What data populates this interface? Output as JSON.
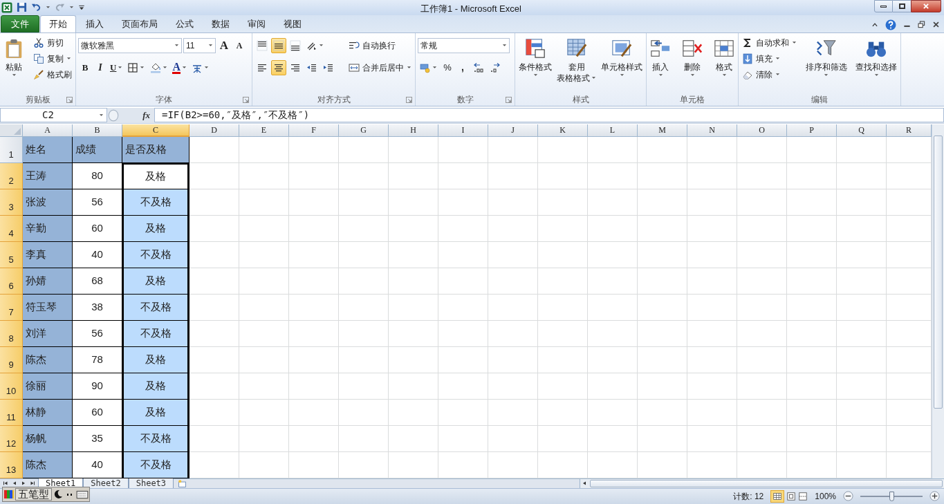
{
  "title_bar": {
    "title": "工作簿1 - Microsoft Excel"
  },
  "tabs": [
    {
      "label": "文件",
      "kind": "file",
      "selected": false
    },
    {
      "label": "开始",
      "kind": "tab",
      "selected": true
    },
    {
      "label": "插入",
      "kind": "tab",
      "selected": false
    },
    {
      "label": "页面布局",
      "kind": "tab",
      "selected": false
    },
    {
      "label": "公式",
      "kind": "tab",
      "selected": false
    },
    {
      "label": "数据",
      "kind": "tab",
      "selected": false
    },
    {
      "label": "审阅",
      "kind": "tab",
      "selected": false
    },
    {
      "label": "视图",
      "kind": "tab",
      "selected": false
    }
  ],
  "ribbon": {
    "groups": [
      {
        "label": "剪贴板",
        "launcher": true,
        "stacks": [
          {
            "kind": "large",
            "label": "粘贴",
            "dropdown": true
          },
          {
            "kind": "stack",
            "lines": [
              [
                {
                  "kind": "small",
                  "label": "剪切"
                }
              ],
              [
                {
                  "kind": "small",
                  "label": "复制",
                  "dropdown": true
                }
              ],
              [
                {
                  "kind": "small",
                  "label": "格式刷"
                }
              ]
            ]
          }
        ]
      },
      {
        "label": "字体",
        "launcher": true,
        "stacks": [
          {
            "kind": "stack",
            "lines": [
              [
                {
                  "kind": "dropdown",
                  "value": "微软雅黑"
                },
                {
                  "kind": "dropdown",
                  "value": "11"
                },
                {
                  "kind": "glyph",
                  "label": "A"
                },
                {
                  "kind": "glyph",
                  "label": "A"
                }
              ],
              [
                {
                  "kind": "glyph",
                  "label": "B"
                },
                {
                  "kind": "glyph",
                  "label": "I"
                },
                {
                  "kind": "glyph",
                  "label": "U",
                  "dropdown": true
                },
                {
                  "kind": "icon",
                  "dropdown": true,
                  "selected": false
                },
                {
                  "kind": "icon",
                  "dropdown": true,
                  "selected": false
                },
                {
                  "kind": "glyph",
                  "label": "A",
                  "dropdown": true
                },
                {
                  "kind": "icon",
                  "dropdown": true,
                  "selected": false
                }
              ]
            ]
          }
        ]
      },
      {
        "label": "对齐方式",
        "launcher": true,
        "stacks": [
          {
            "kind": "stack",
            "lines": [
              [
                {
                  "kind": "icon",
                  "selected": false
                },
                {
                  "kind": "icon",
                  "selected": true
                },
                {
                  "kind": "icon",
                  "selected": false
                },
                {
                  "kind": "icon",
                  "dropdown": true,
                  "selected": false
                }
              ],
              [
                {
                  "kind": "icon",
                  "selected": false
                },
                {
                  "kind": "icon",
                  "selected": true
                },
                {
                  "kind": "icon",
                  "selected": false
                },
                {
                  "kind": "icon",
                  "selected": false
                },
                {
                  "kind": "icon",
                  "selected": false
                }
              ]
            ]
          },
          {
            "kind": "stack",
            "lines": [
              [
                {
                  "kind": "small",
                  "label": "自动换行"
                }
              ],
              [
                {
                  "kind": "small",
                  "label": "合并后居中",
                  "dropdown": true
                }
              ]
            ]
          }
        ]
      },
      {
        "label": "数字",
        "launcher": true,
        "stacks": [
          {
            "kind": "stack",
            "lines": [
              [
                {
                  "kind": "dropdown",
                  "value": "常规"
                }
              ],
              [
                {
                  "kind": "icon",
                  "dropdown": true,
                  "selected": false
                },
                {
                  "kind": "glyph",
                  "label": "%"
                },
                {
                  "kind": "glyph",
                  "label": ","
                },
                {
                  "kind": "icon",
                  "selected": false
                },
                {
                  "kind": "icon",
                  "selected": false
                }
              ]
            ]
          }
        ]
      },
      {
        "label": "样式",
        "stacks": [
          {
            "kind": "large",
            "label": "条件格式",
            "dropdown": true
          },
          {
            "kind": "large",
            "label": "套用",
            "label_2": "表格格式",
            "dropdown": true
          },
          {
            "kind": "large",
            "label": "单元格样式",
            "dropdown": true
          }
        ]
      },
      {
        "label": "单元格",
        "stacks": [
          {
            "kind": "large",
            "label": "插入",
            "dropdown": true
          },
          {
            "kind": "large",
            "label": "删除",
            "dropdown": true
          },
          {
            "kind": "large",
            "label": "格式",
            "dropdown": true
          }
        ]
      },
      {
        "label": "编辑",
        "stacks": [
          {
            "kind": "stack",
            "lines": [
              [
                {
                  "kind": "small",
                  "label": "自动求和",
                  "dropdown": true
                }
              ],
              [
                {
                  "kind": "small",
                  "label": "填充",
                  "dropdown": true
                }
              ],
              [
                {
                  "kind": "small",
                  "label": "清除",
                  "dropdown": true
                }
              ]
            ]
          },
          {
            "kind": "large",
            "label": "排序和筛选",
            "dropdown": true
          },
          {
            "kind": "large",
            "label": "查找和选择",
            "dropdown": true
          }
        ]
      }
    ]
  },
  "formula_bar": {
    "name_box": "C2",
    "fx": "fx",
    "formula": "=IF(B2>=60,″及格″,″不及格″)"
  },
  "table": {
    "columns": [
      {
        "label": "A",
        "selected": false
      },
      {
        "label": "B",
        "selected": false
      },
      {
        "label": "C",
        "selected": true
      },
      {
        "label": "D",
        "selected": false
      },
      {
        "label": "E",
        "selected": false
      },
      {
        "label": "F",
        "selected": false
      },
      {
        "label": "G",
        "selected": false
      },
      {
        "label": "H",
        "selected": false
      },
      {
        "label": "I",
        "selected": false
      },
      {
        "label": "J",
        "selected": false
      },
      {
        "label": "K",
        "selected": false
      },
      {
        "label": "L",
        "selected": false
      },
      {
        "label": "M",
        "selected": false
      },
      {
        "label": "N",
        "selected": false
      },
      {
        "label": "O",
        "selected": false
      },
      {
        "label": "P",
        "selected": false
      },
      {
        "label": "Q",
        "selected": false
      },
      {
        "label": "R",
        "selected": false
      }
    ],
    "rows": [
      {
        "header": "1",
        "selected": false,
        "cells": [
          {
            "text": "姓名"
          },
          {
            "text": "成绩"
          },
          {
            "text": "是否及格"
          }
        ]
      },
      {
        "header": "2",
        "selected": true,
        "cells": [
          {
            "text": "王涛"
          },
          {
            "text": "80"
          },
          {
            "text": "及格",
            "selected": true,
            "active": true
          }
        ]
      },
      {
        "header": "3",
        "selected": true,
        "cells": [
          {
            "text": "张波"
          },
          {
            "text": "56"
          },
          {
            "text": "不及格",
            "selected": true,
            "active": false
          }
        ]
      },
      {
        "header": "4",
        "selected": true,
        "cells": [
          {
            "text": "辛勤"
          },
          {
            "text": "60"
          },
          {
            "text": "及格",
            "selected": true,
            "active": false
          }
        ]
      },
      {
        "header": "5",
        "selected": true,
        "cells": [
          {
            "text": "李真"
          },
          {
            "text": "40"
          },
          {
            "text": "不及格",
            "selected": true,
            "active": false
          }
        ]
      },
      {
        "header": "6",
        "selected": true,
        "cells": [
          {
            "text": "孙婧"
          },
          {
            "text": "68"
          },
          {
            "text": "及格",
            "selected": true,
            "active": false
          }
        ]
      },
      {
        "header": "7",
        "selected": true,
        "cells": [
          {
            "text": "符玉琴"
          },
          {
            "text": "38"
          },
          {
            "text": "不及格",
            "selected": true,
            "active": false
          }
        ]
      },
      {
        "header": "8",
        "selected": true,
        "cells": [
          {
            "text": "刘洋"
          },
          {
            "text": "56"
          },
          {
            "text": "不及格",
            "selected": true,
            "active": false
          }
        ]
      },
      {
        "header": "9",
        "selected": true,
        "cells": [
          {
            "text": "陈杰"
          },
          {
            "text": "78"
          },
          {
            "text": "及格",
            "selected": true,
            "active": false
          }
        ]
      },
      {
        "header": "10",
        "selected": true,
        "cells": [
          {
            "text": "徐丽"
          },
          {
            "text": "90"
          },
          {
            "text": "及格",
            "selected": true,
            "active": false
          }
        ]
      },
      {
        "header": "11",
        "selected": true,
        "cells": [
          {
            "text": "林静"
          },
          {
            "text": "60"
          },
          {
            "text": "及格",
            "selected": true,
            "active": false
          }
        ]
      },
      {
        "header": "12",
        "selected": true,
        "cells": [
          {
            "text": "杨帆"
          },
          {
            "text": "35"
          },
          {
            "text": "不及格",
            "selected": true,
            "active": false
          }
        ]
      },
      {
        "header": "13",
        "selected": true,
        "cells": [
          {
            "text": "陈杰"
          },
          {
            "text": "40"
          },
          {
            "text": "不及格",
            "selected": true,
            "active": false
          }
        ]
      }
    ]
  },
  "sheets": [
    {
      "label": "Sheet1",
      "selected": true
    },
    {
      "label": "Sheet2",
      "selected": false
    },
    {
      "label": "Sheet3",
      "selected": false
    }
  ],
  "ime_toolbar": {
    "mode": "五笔型"
  },
  "status_bar": {
    "count": "计数: 12",
    "zoom": "100%",
    "zoom_slider": {
      "level": 0.5
    }
  }
}
